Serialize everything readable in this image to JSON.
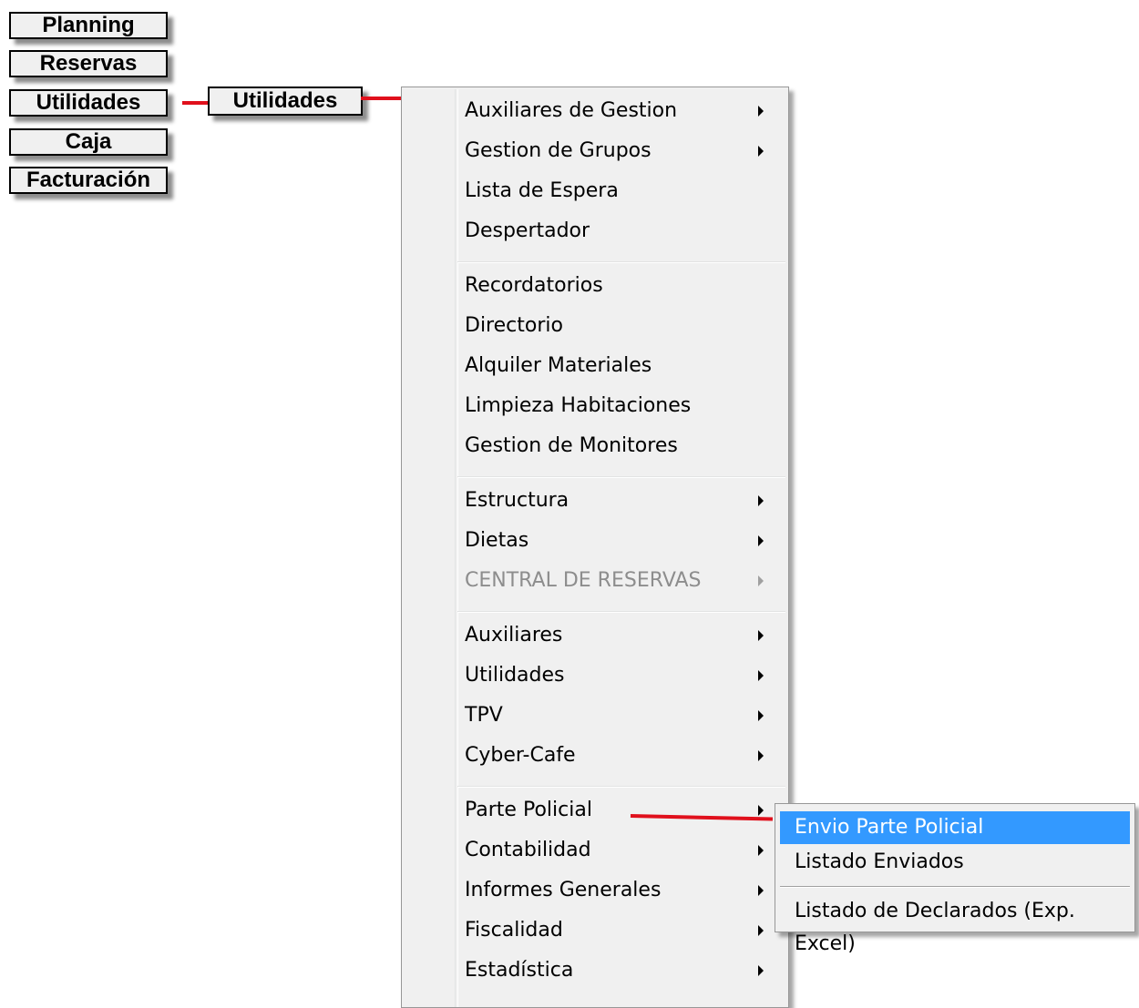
{
  "left_buttons": [
    "Planning",
    "Reservas",
    "Utilidades",
    "Caja",
    "Facturación"
  ],
  "second_button": "Utilidades",
  "menu": {
    "items": [
      {
        "label": "Auxiliares de Gestion",
        "submenu": true
      },
      {
        "label": "Gestion de Grupos",
        "submenu": true
      },
      {
        "label": "Lista de Espera",
        "submenu": false
      },
      {
        "label": "Despertador",
        "submenu": false
      },
      {
        "label": "Recordatorios",
        "submenu": false
      },
      {
        "label": "Directorio",
        "submenu": false
      },
      {
        "label": "Alquiler Materiales",
        "submenu": false
      },
      {
        "label": "Limpieza Habitaciones",
        "submenu": false
      },
      {
        "label": "Gestion de Monitores",
        "submenu": false
      },
      {
        "label": "Estructura",
        "submenu": true
      },
      {
        "label": "Dietas",
        "submenu": true
      },
      {
        "label": "CENTRAL DE RESERVAS",
        "submenu": true,
        "disabled": true
      },
      {
        "label": "Auxiliares",
        "submenu": true
      },
      {
        "label": "Utilidades",
        "submenu": true
      },
      {
        "label": "TPV",
        "submenu": true
      },
      {
        "label": "Cyber-Cafe",
        "submenu": true
      },
      {
        "label": "Parte Policial",
        "submenu": true
      },
      {
        "label": "Contabilidad",
        "submenu": true
      },
      {
        "label": "Informes Generales",
        "submenu": true
      },
      {
        "label": "Fiscalidad",
        "submenu": true
      },
      {
        "label": "Estadística",
        "submenu": true
      }
    ]
  },
  "submenu": {
    "items": [
      {
        "label": "Envio Parte Policial",
        "selected": true
      },
      {
        "label": "Listado Enviados"
      },
      {
        "label": "Listado de Declarados (Exp. Excel)"
      }
    ]
  },
  "colors": {
    "highlight": "#3399ff",
    "connector": "#e0101c",
    "disabled_text": "#8d8d8d"
  }
}
